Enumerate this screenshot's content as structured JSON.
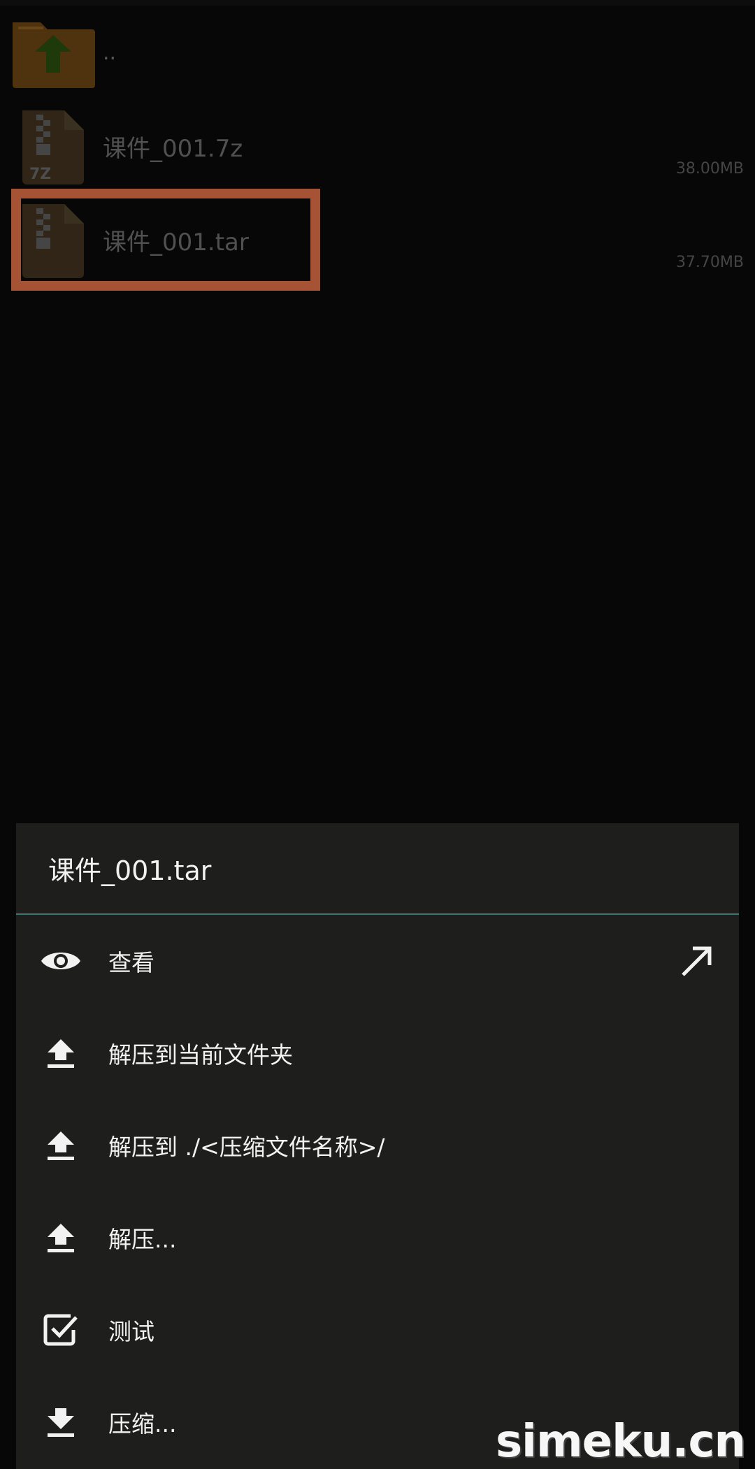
{
  "files": [
    {
      "name": "..",
      "size": "",
      "icon": "folder-up-icon"
    },
    {
      "name": "课件_001.7z",
      "size": "38.00MB",
      "icon": "archive-7z-icon",
      "badge": "7Z"
    },
    {
      "name": "课件_001.tar",
      "size": "37.70MB",
      "icon": "archive-icon"
    }
  ],
  "sheet": {
    "title": "课件_001.tar",
    "items": [
      {
        "label": "查看",
        "icon": "eye-icon"
      },
      {
        "label": "解压到当前文件夹",
        "icon": "upload-icon"
      },
      {
        "label": "解压到 ./<压缩文件名称>/",
        "icon": "upload-icon"
      },
      {
        "label": "解压...",
        "icon": "upload-icon"
      },
      {
        "label": "测试",
        "icon": "checkbox-icon"
      },
      {
        "label": "压缩...",
        "icon": "download-icon"
      }
    ]
  },
  "watermark": "simeku.cn",
  "colors": {
    "highlight": "#ff7f50",
    "sheet_bg": "#1e1e1c",
    "divider": "#3e7474"
  }
}
